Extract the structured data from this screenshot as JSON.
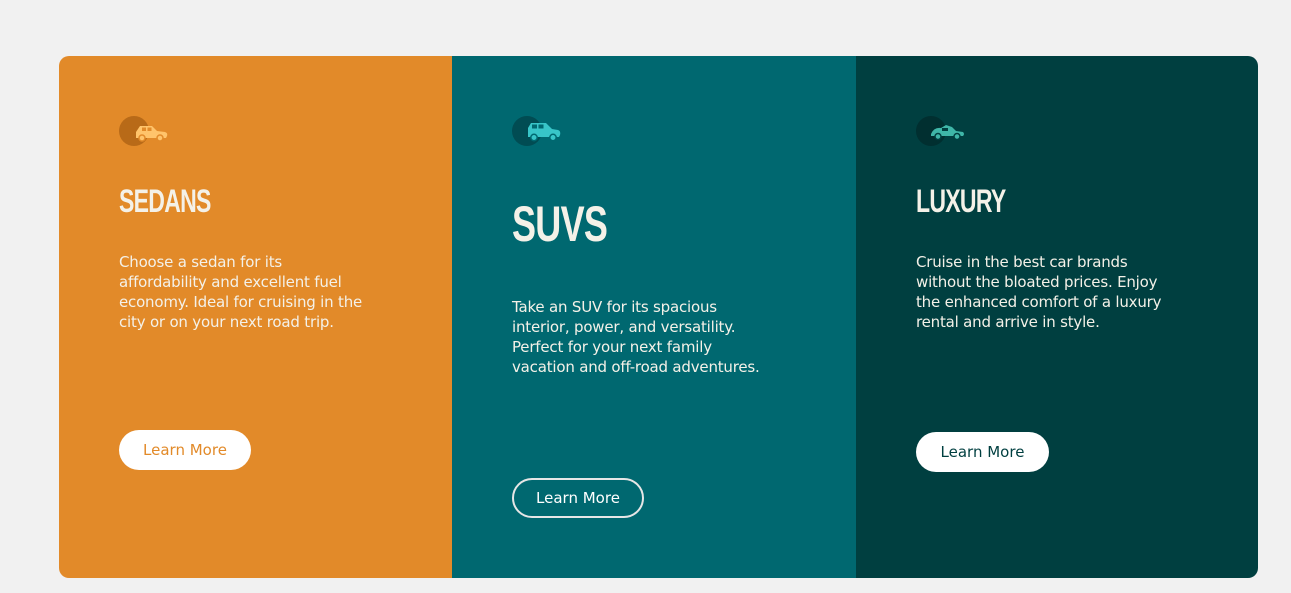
{
  "colors": {
    "page_background": "#f1f1f1",
    "sedans_bg": "#e28a29",
    "suvs_bg": "#006870",
    "luxury_bg": "#003f40",
    "card_text": "#f4f1e8",
    "button_bg": "#ffffff"
  },
  "cards": [
    {
      "id": "sedans",
      "icon": "sedan-car-icon",
      "title": "SEDANS",
      "description_lines": [
        "Choose a sedan for its",
        "affordability and excellent fuel",
        "economy. Ideal for cruising in the",
        "city or on your next road trip."
      ],
      "button_label": "Learn More"
    },
    {
      "id": "suvs",
      "icon": "suv-car-icon",
      "title": "SUVS",
      "description_lines": [
        "Take an SUV for its spacious",
        "interior, power, and versatility.",
        "Perfect for your next family",
        "vacation and off-road adventures."
      ],
      "button_label": "Learn More"
    },
    {
      "id": "luxury",
      "icon": "luxury-car-icon",
      "title": "LUXURY",
      "description_lines": [
        "Cruise in the best car brands",
        "without the bloated prices. Enjoy",
        "the enhanced comfort of a luxury",
        "rental and arrive in style."
      ],
      "button_label": "Learn More"
    }
  ]
}
